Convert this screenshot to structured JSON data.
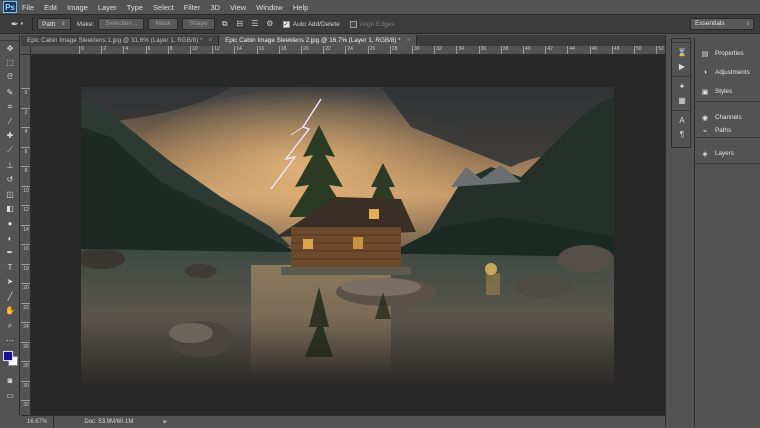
{
  "app": {
    "logo": "Ps"
  },
  "menu": [
    "File",
    "Edit",
    "Image",
    "Layer",
    "Type",
    "Select",
    "Filter",
    "3D",
    "View",
    "Window",
    "Help"
  ],
  "options": {
    "tool_icon": "pen-tool-icon",
    "mode_value": "Path",
    "make_label": "Make:",
    "selection_btn": "Selection...",
    "mask_btn": "Mask",
    "shape_btn": "Shape",
    "auto_add_delete": "Auto Add/Delete",
    "auto_add_delete_checked": true,
    "align_edges": "Align Edges",
    "align_edges_checked": false,
    "workspace": "Essentials"
  },
  "tabs": [
    {
      "label": "Epic Cabin Image Sleeklens 1.jpg @ 31.6% (Layer 1, RGB/8) *",
      "close": "×"
    },
    {
      "label": "Epic Cabin Image Sleeklens 2.jpg @ 16.7% (Layer 1, RGB/8) *",
      "close": "×"
    }
  ],
  "ruler_h": [
    "0",
    "2",
    "4",
    "6",
    "8",
    "10",
    "12",
    "14",
    "16",
    "18",
    "20",
    "22",
    "24",
    "26",
    "28",
    "30",
    "32",
    "34",
    "36",
    "38",
    "40",
    "42",
    "44",
    "46",
    "48",
    "50",
    "52"
  ],
  "ruler_v": [
    "0",
    "2",
    "4",
    "6",
    "8",
    "10",
    "12",
    "14",
    "16",
    "18",
    "20",
    "22",
    "24",
    "26",
    "28",
    "30",
    "32"
  ],
  "status": {
    "zoom": "16.67%",
    "doc": "Doc: 53.9M/60.1M"
  },
  "panels": [
    {
      "icon": "properties-icon",
      "label": "Properties"
    },
    {
      "icon": "adjustments-icon",
      "label": "Adjustments"
    },
    {
      "icon": "styles-icon",
      "label": "Styles"
    },
    {
      "icon": "channels-icon",
      "label": "Channels"
    },
    {
      "icon": "paths-icon",
      "label": "Paths"
    },
    {
      "icon": "layers-icon",
      "label": "Layers"
    }
  ],
  "colors": {
    "foreground": "#14109a",
    "background": "#ffffff",
    "canvas_bg": "#282828",
    "ui_bg": "#535353"
  }
}
